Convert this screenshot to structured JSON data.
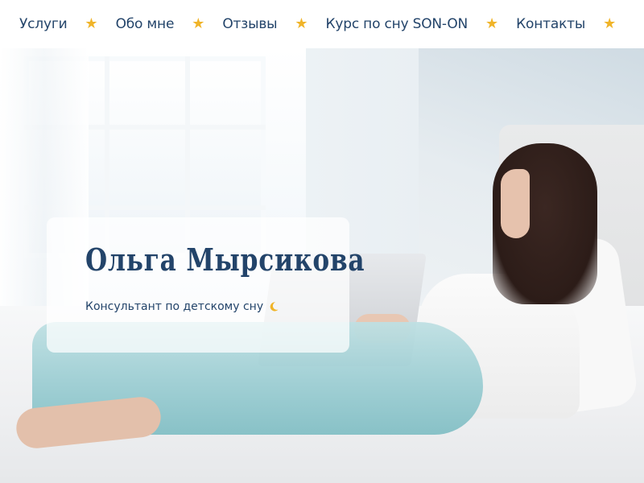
{
  "nav": {
    "items": [
      {
        "label": "Услуги"
      },
      {
        "label": "Обо мне"
      },
      {
        "label": "Отзывы"
      },
      {
        "label": "Курс по сну SON-ON"
      },
      {
        "label": "Контакты"
      }
    ],
    "separator_icon": "star-icon",
    "separator_color": "#f0b429",
    "text_color": "#23446a"
  },
  "intro": {
    "name": "Ольга Мырсикова",
    "subtitle": "Консультант по детскому сну",
    "subtitle_icon": "crescent-moon-icon"
  }
}
